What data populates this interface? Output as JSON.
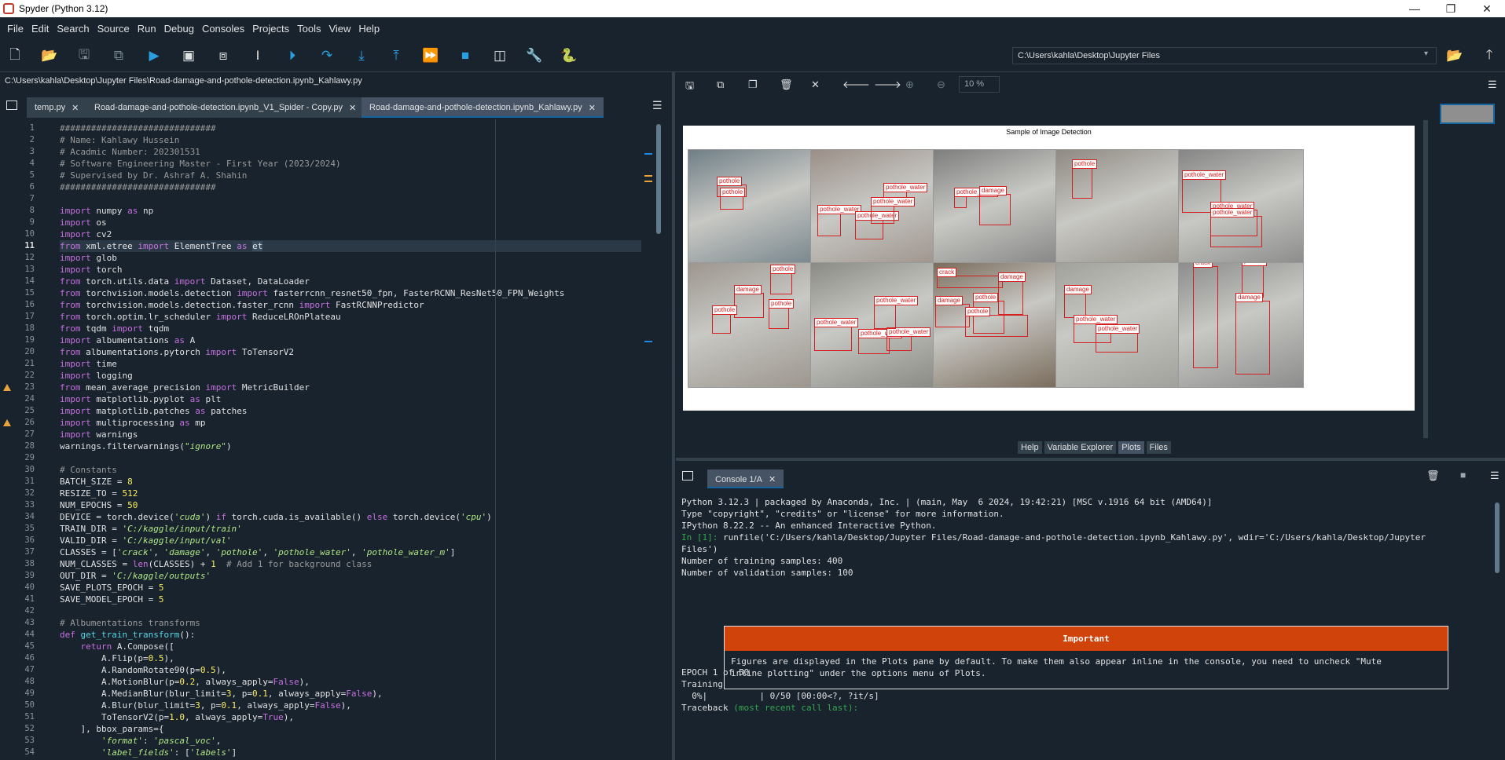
{
  "window": {
    "title": "Spyder (Python 3.12)",
    "controls": [
      "—",
      "❐",
      "✕"
    ]
  },
  "menu": [
    "File",
    "Edit",
    "Search",
    "Source",
    "Run",
    "Debug",
    "Consoles",
    "Projects",
    "Tools",
    "View",
    "Help"
  ],
  "toolbar": {
    "working_dir": "C:\\Users\\kahla\\Desktop\\Jupyter Files"
  },
  "editor": {
    "file_path": "C:\\Users\\kahla\\Desktop\\Jupyter Files\\Road-damage-and-pothole-detection.ipynb_Kahlawy.py",
    "tabs": [
      {
        "label": "temp.py"
      },
      {
        "label": "Road-damage-and-pothole-detection.ipynb_V1_Spider - Copy.py"
      },
      {
        "label": "Road-damage-and-pothole-detection.ipynb_Kahlawy.py"
      }
    ],
    "current_line": 11,
    "warning_lines": [
      23,
      26
    ]
  },
  "plots": {
    "zoom": "10 %",
    "figure_title": "Sample of Image Detection",
    "images": [
      {
        "boxes": [
          {
            "label": "pothole"
          },
          {
            "label": "pothole"
          }
        ]
      },
      {
        "boxes": [
          {
            "label": "pothole_water"
          },
          {
            "label": "pothole_water"
          },
          {
            "label": "pothole_water"
          },
          {
            "label": "pothole_water"
          }
        ]
      },
      {
        "boxes": [
          {
            "label": "pothole_water"
          },
          {
            "label": "damage"
          }
        ]
      },
      {
        "boxes": [
          {
            "label": "pothole"
          }
        ]
      },
      {
        "boxes": [
          {
            "label": "pothole_water"
          },
          {
            "label": "pothole_water"
          },
          {
            "label": "pothole_water"
          }
        ]
      },
      {
        "boxes": [
          {
            "label": "pothole"
          },
          {
            "label": "damage"
          },
          {
            "label": "pothole"
          },
          {
            "label": "pothole"
          }
        ]
      },
      {
        "boxes": [
          {
            "label": "pothole_water"
          },
          {
            "label": "pothole_water"
          },
          {
            "label": "pothole_water"
          },
          {
            "label": "pothole_water"
          }
        ]
      },
      {
        "boxes": [
          {
            "label": "crack"
          },
          {
            "label": "damage"
          },
          {
            "label": "damage"
          },
          {
            "label": "pothole"
          },
          {
            "label": "pothole"
          }
        ]
      },
      {
        "boxes": [
          {
            "label": "damage"
          },
          {
            "label": "pothole_water"
          },
          {
            "label": "pothole_water"
          }
        ]
      },
      {
        "boxes": [
          {
            "label": "crack"
          },
          {
            "label": "pothole"
          },
          {
            "label": "damage"
          }
        ]
      }
    ]
  },
  "pane_tabs": [
    "Help",
    "Variable Explorer",
    "Plots",
    "Files"
  ],
  "console": {
    "tab": "Console 1/A",
    "lines": [
      "Python 3.12.3 | packaged by Anaconda, Inc. | (main, May  6 2024, 19:42:21) [MSC v.1916 64 bit (AMD64)]",
      "Type \"copyright\", \"credits\" or \"license\" for more information.",
      "",
      "IPython 8.22.2 -- An enhanced Interactive Python.",
      ""
    ],
    "prompt": "In [1]:",
    "run_cmd": " runfile('C:/Users/kahla/Desktop/Jupyter Files/Road-damage-and-pothole-detection.ipynb_Kahlawy.py', wdir='C:/Users/kahla/Desktop/Jupyter",
    "run_cmd2": "Files')",
    "train_samples": "Number of training samples: 400",
    "valid_samples": "Number of validation samples: 100",
    "important_title": "Important",
    "important_body1": "Figures are displayed in the Plots pane by default. To make them also appear inline in the console, you need to uncheck \"Mute",
    "important_body2": "inline plotting\" under the options menu of Plots.",
    "epoch": "EPOCH 1 of 50",
    "training": "Training",
    "progress": "  0%|          | 0/50 [00:00<?, ?it/s]",
    "traceback": "Traceback",
    "traceback_rest": " (most recent call last):"
  }
}
